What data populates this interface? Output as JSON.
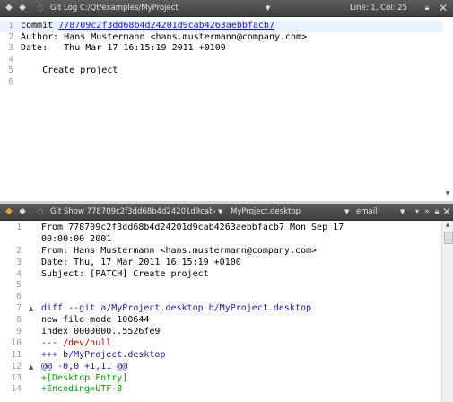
{
  "top_toolbar": {
    "title": "Git Log C:/Qt/examples/MyProject",
    "position": "Line: 1, Col: 25"
  },
  "log_editor": {
    "lines": [
      {
        "num": "1",
        "pre": "commit ",
        "hash": "778709c2f3dd68b4d24201d9cab4263aebbfacb7"
      },
      {
        "num": "2",
        "text": "Author: Hans Mustermann <hans.mustermann@company.com>"
      },
      {
        "num": "3",
        "text": "Date:   Thu Mar 17 16:15:19 2011 +0100"
      },
      {
        "num": "4",
        "text": ""
      },
      {
        "num": "5",
        "text": "    Create project"
      },
      {
        "num": "6",
        "text": ""
      }
    ]
  },
  "bottom_toolbar": {
    "title": "Git Show 778709c2f3dd68b4d24201d9cab426...",
    "file": "MyProject.desktop",
    "encoding": "email"
  },
  "show_editor": {
    "lines": [
      {
        "num": "1",
        "text": "From 778709c2f3dd68b4d24201d9cab4263aebbfacb7 Mon Sep 17",
        "color": "default"
      },
      {
        "num": "",
        "text": "00:00:00 2001",
        "color": "default"
      },
      {
        "num": "2",
        "text": "From: Hans Mustermann <hans.mustermann@company.com>",
        "color": "default"
      },
      {
        "num": "3",
        "text": "Date: Thu, 17 Mar 2011 16:15:19 +0100",
        "color": "default"
      },
      {
        "num": "4",
        "text": "Subject: [PATCH] Create project",
        "color": "default"
      },
      {
        "num": "5",
        "text": "",
        "color": "default"
      },
      {
        "num": "6",
        "text": "",
        "color": "default"
      },
      {
        "num": "7",
        "text": "diff --git a/MyProject.desktop b/MyProject.desktop",
        "color": "blue",
        "fold": "▲"
      },
      {
        "num": "8",
        "text": "new file mode 100644",
        "color": "default"
      },
      {
        "num": "9",
        "text": "index 0000000..5526fe9",
        "color": "default"
      },
      {
        "num": "10",
        "text": "--- /dev/null",
        "color": "red"
      },
      {
        "num": "11",
        "text": "+++ b/MyProject.desktop",
        "color": "blue"
      },
      {
        "num": "12",
        "text": "@@ -0,0 +1,11 @@",
        "color": "blue",
        "fold": "▲"
      },
      {
        "num": "13",
        "text": "+[Desktop Entry]",
        "color": "green"
      },
      {
        "num": "14",
        "text": "+Encoding=UTF-8",
        "color": "green"
      }
    ]
  }
}
